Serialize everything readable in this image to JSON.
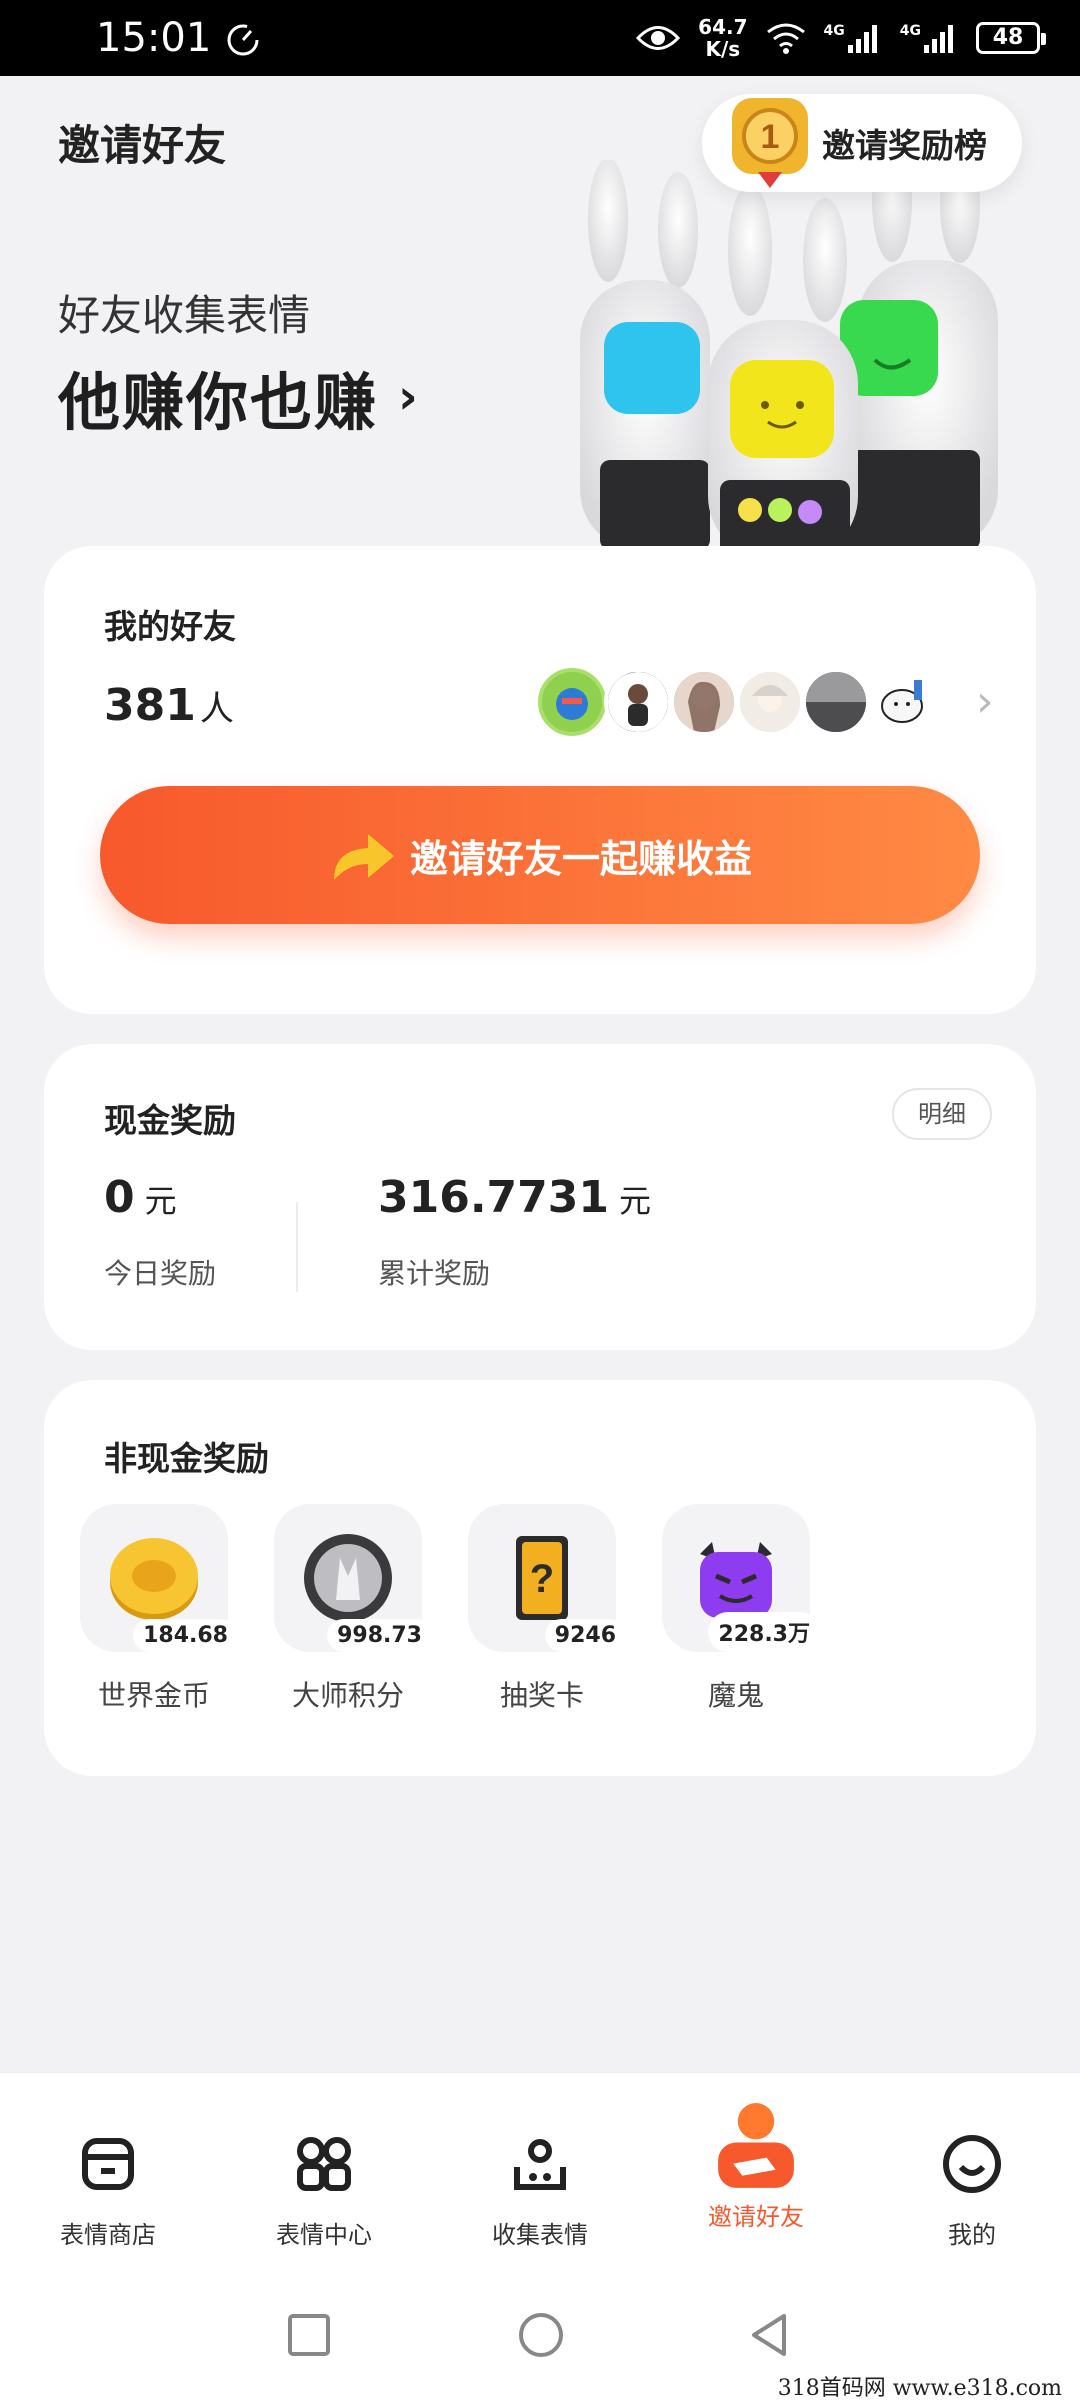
{
  "status_bar": {
    "time": "15:01",
    "net_speed_value": "64.7",
    "net_speed_unit": "K/s",
    "signal_1": "4G",
    "signal_2": "4G",
    "battery": "48"
  },
  "header": {
    "title": "邀请好友",
    "rank_button": "邀请奖励榜",
    "medal_number": "1"
  },
  "hero": {
    "subtitle": "好友收集表情",
    "headline": "他赚你也赚",
    "chevron": "›"
  },
  "friends": {
    "title": "我的好友",
    "count": "381",
    "count_unit": "人",
    "avatar_colors": [
      "#8fd14f",
      "#3a2a22",
      "#d6b3a0",
      "#e8e0d8",
      "#6f6f72",
      "#f4f4f4"
    ],
    "invite_button": "邀请好友一起赚收益"
  },
  "cash": {
    "title": "现金奖励",
    "detail_button": "明细",
    "today_value": "0",
    "today_unit": "元",
    "today_label": "今日奖励",
    "total_value": "316.7731",
    "total_unit": "元",
    "total_label": "累计奖励"
  },
  "noncash": {
    "title": "非现金奖励",
    "items": [
      {
        "name": "世界金币",
        "value": "184.68",
        "icon": "gold-coin-icon"
      },
      {
        "name": "大师积分",
        "value": "998.73",
        "icon": "master-points-icon"
      },
      {
        "name": "抽奖卡",
        "value": "9246",
        "icon": "lottery-card-icon"
      },
      {
        "name": "魔鬼",
        "value": "228.3万",
        "icon": "devil-icon"
      }
    ]
  },
  "bottom_nav": {
    "items": [
      {
        "label": "表情商店",
        "icon": "shop-icon"
      },
      {
        "label": "表情中心",
        "icon": "grid-icon"
      },
      {
        "label": "收集表情",
        "icon": "collect-icon"
      },
      {
        "label": "邀请好友",
        "icon": "invite-icon",
        "active": true
      },
      {
        "label": "我的",
        "icon": "smile-icon"
      }
    ]
  },
  "watermark": "318首码网  www.e318.com",
  "colors": {
    "accent": "#f7592c",
    "background": "#f2f2f4"
  }
}
